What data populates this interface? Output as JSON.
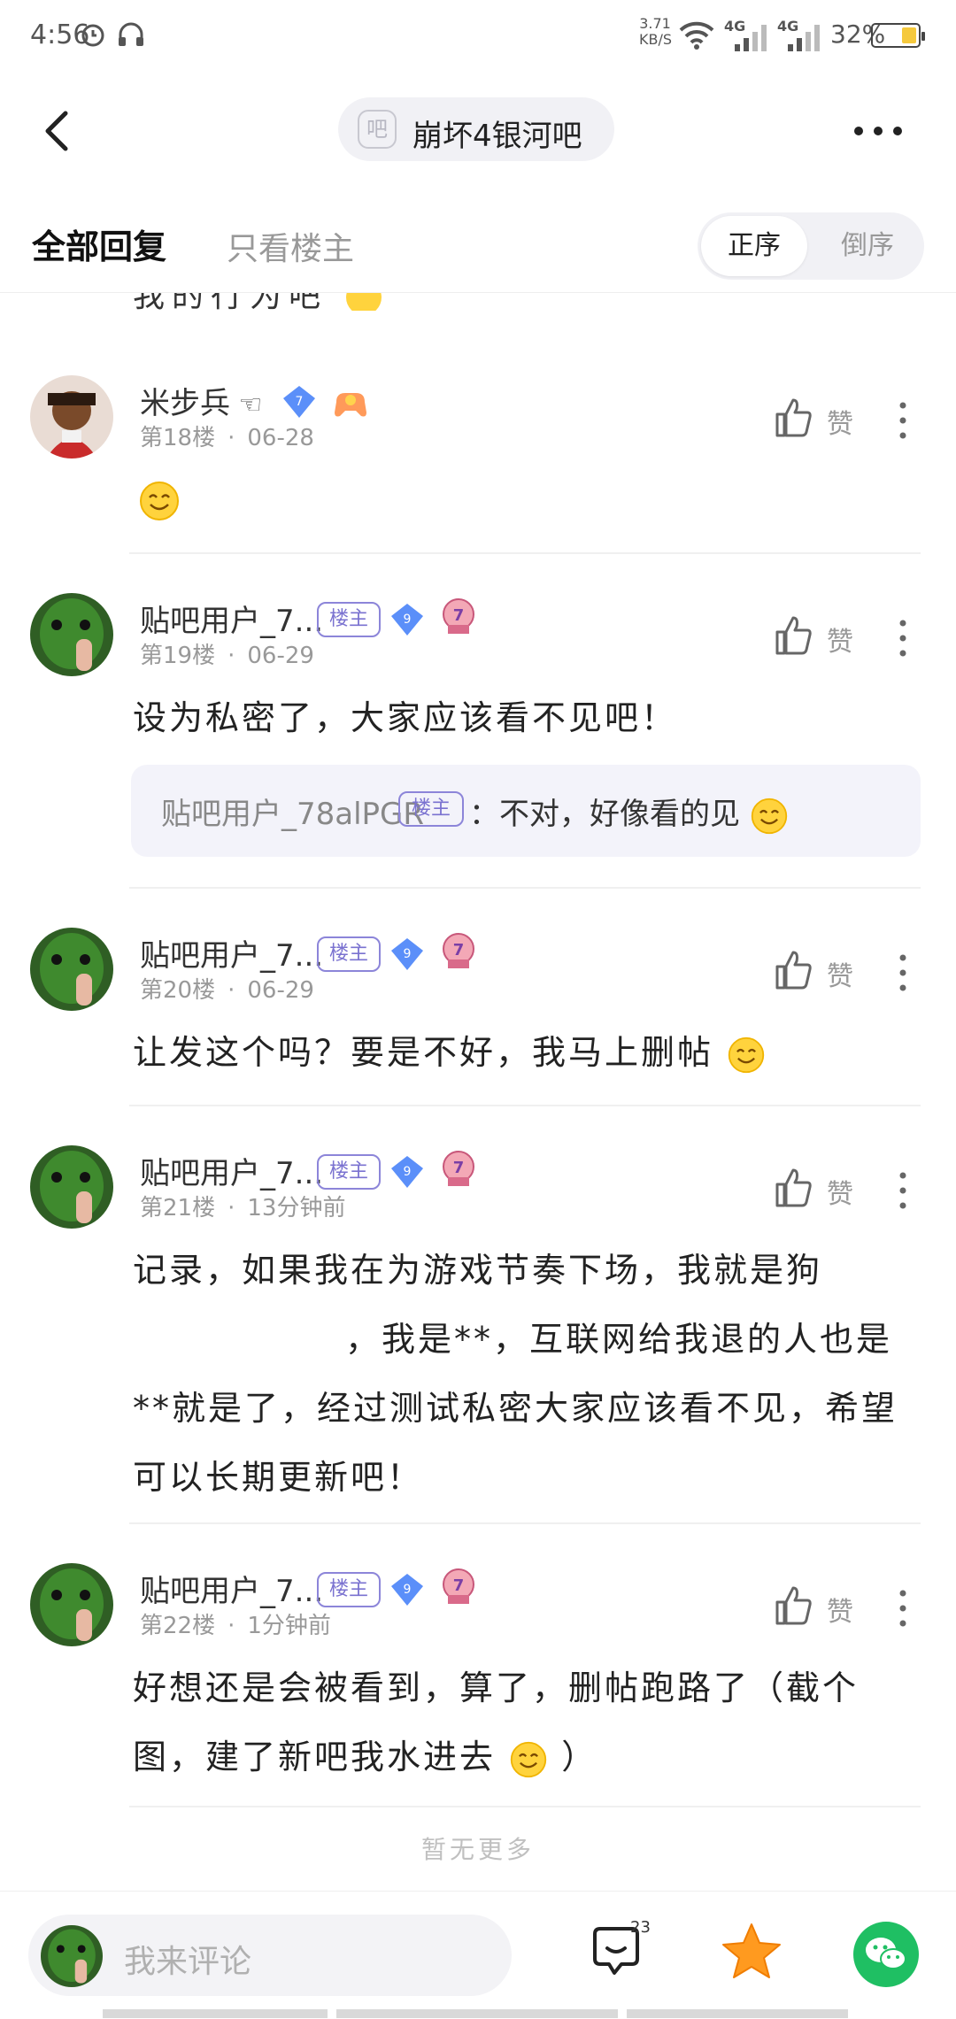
{
  "status_bar": {
    "time": "4:56",
    "net_speed": "3.71",
    "net_unit": "KB/S",
    "sig1_label": "4G",
    "sig2_label": "4G",
    "battery": "32%"
  },
  "header": {
    "forum_badge": "吧",
    "forum_name": "崩坏4银河吧"
  },
  "tabs": {
    "all_replies": "全部回复",
    "owner_only": "只看楼主",
    "order_asc": "正序",
    "order_desc": "倒序"
  },
  "partial_text": "我的行为吧",
  "owner_badge": "楼主",
  "like_label": "赞",
  "posts": [
    {
      "user": "米步兵",
      "level": "7",
      "floor": "第18楼",
      "date": "06-28",
      "content": ""
    },
    {
      "user": "贴吧用户_7...",
      "level": "9",
      "medal": "7",
      "floor": "第19楼",
      "date": "06-29",
      "content": "设为私密了，大家应该看不见吧！",
      "quote_user": "贴吧用户_78alPGR",
      "quote_text": "：不对，好像看的见"
    },
    {
      "user": "贴吧用户_7...",
      "level": "9",
      "medal": "7",
      "floor": "第20楼",
      "date": "06-29",
      "content": "让发这个吗？要是不好，我马上删帖"
    },
    {
      "user": "贴吧用户_7...",
      "level": "9",
      "medal": "7",
      "floor": "第21楼",
      "date": "13分钟前",
      "lines": [
        "记录，如果我在为游戏节奏下场，我就是狗",
        "，我是**，互联网给我退的人也是",
        "**就是了，经过测试私密大家应该看不见，希望",
        "可以长期更新吧！"
      ]
    },
    {
      "user": "贴吧用户_7...",
      "level": "9",
      "medal": "7",
      "floor": "第22楼",
      "date": "1分钟前",
      "lines": [
        "好想还是会被看到，算了，删帖跑路了（截个",
        "图，建了新吧我水进去",
        "）"
      ]
    }
  ],
  "no_more": "暂无更多",
  "bottom_bar": {
    "placeholder": "我来评论",
    "comment_count": "23"
  },
  "colors": {
    "accent_purple": "#7a72d0",
    "gem_blue": "#5b8ff9",
    "star_orange": "#ff9a1f",
    "wechat_green": "#1fbf63"
  }
}
